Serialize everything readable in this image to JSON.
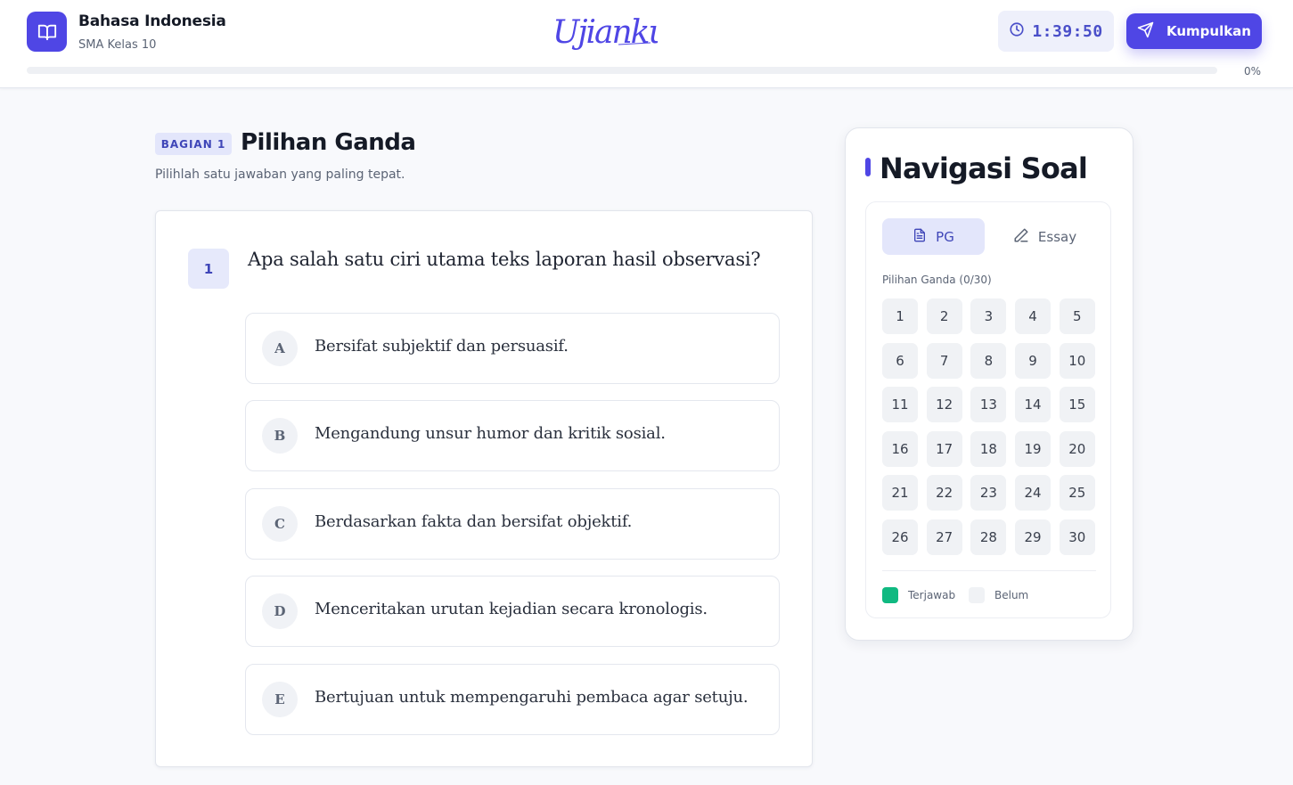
{
  "header": {
    "subject": "Bahasa Indonesia",
    "class_level": "SMA Kelas 10",
    "logo_text": "Ujianku",
    "timer": "1:39:50",
    "submit_label": "Kumpulkan",
    "progress_percent": 0,
    "progress_text": "0%"
  },
  "section": {
    "badge": "BAGIAN 1",
    "title": "Pilihan Ganda",
    "instruction": "Pilihlah satu jawaban yang paling tepat."
  },
  "question": {
    "number": "1",
    "text": "Apa salah satu ciri utama teks laporan hasil observasi?",
    "options": [
      {
        "letter": "A",
        "text": "Bersifat subjektif dan persuasif."
      },
      {
        "letter": "B",
        "text": "Mengandung unsur humor dan kritik sosial."
      },
      {
        "letter": "C",
        "text": "Berdasarkan fakta dan bersifat objektif."
      },
      {
        "letter": "D",
        "text": "Menceritakan urutan kejadian secara kronologis."
      },
      {
        "letter": "E",
        "text": "Bertujuan untuk mempengaruhi pembaca agar setuju."
      }
    ]
  },
  "navigation": {
    "title": "Navigasi Soal",
    "tabs": [
      {
        "label": "PG",
        "icon": "file-text-icon",
        "active": true
      },
      {
        "label": "Essay",
        "icon": "pencil-icon",
        "active": false
      }
    ],
    "count_label": "Pilihan Ganda (0/30)",
    "numbers": [
      "1",
      "2",
      "3",
      "4",
      "5",
      "6",
      "7",
      "8",
      "9",
      "10",
      "11",
      "12",
      "13",
      "14",
      "15",
      "16",
      "17",
      "18",
      "19",
      "20",
      "21",
      "22",
      "23",
      "24",
      "25",
      "26",
      "27",
      "28",
      "29",
      "30"
    ],
    "legend": [
      {
        "label": "Terjawab",
        "color": "#10b981"
      },
      {
        "label": "Belum",
        "color": "#f0f2f5"
      }
    ]
  },
  "colors": {
    "accent": "#4f46e5",
    "answered": "#10b981"
  }
}
